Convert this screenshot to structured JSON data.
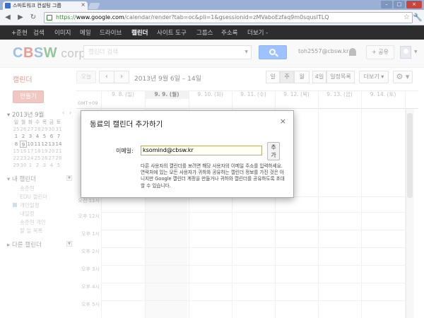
{
  "browser": {
    "tab_title": "스마트워크 컨설팅 그룹",
    "tab_close": "×",
    "url_scheme": "https://",
    "url_domain": "www.google.com",
    "url_path": "/calendar/render?tab=oc&pli=1&gsessionid=zMVaboEzfaq9m0squsITLQ",
    "back": "◀",
    "forward": "▶",
    "reload": "↻",
    "star": "☆",
    "wrench": "🔧",
    "win_min": "–",
    "win_max": "□",
    "win_close": "×"
  },
  "gbar": {
    "items": [
      "+준현",
      "검색",
      "이미지",
      "메일",
      "드라이브",
      "캘린더",
      "사이트 도구",
      "그룹스",
      "주소록",
      "더보기 -"
    ]
  },
  "header": {
    "logo_c": "C",
    "logo_b": "B",
    "logo_s": "S",
    "logo_w": "W",
    "logo_corp": " corp.",
    "search_placeholder": "캘린더 검색",
    "search_dd": "▼",
    "email": "toh2557@cbsw.kr",
    "share_label": "+ 공유",
    "avatar_dd": "▼"
  },
  "toolbar": {
    "calendar_title": "캘린더",
    "today": "오늘",
    "prev": "‹",
    "next": "›",
    "range": "2013년 9월 6일 – 14일",
    "views": [
      "일",
      "주",
      "월",
      "4일",
      "일정목록"
    ],
    "more": "더보기 ▾",
    "gear": "⚙ ▾"
  },
  "sidebar": {
    "create": "만들기",
    "mini_title": "▾ 2013년 9월",
    "mini_prev": "‹",
    "mini_next": "›",
    "weekdays": [
      "일",
      "월",
      "화",
      "수",
      "목",
      "금",
      "토"
    ],
    "weeks": [
      [
        "25",
        "26",
        "27",
        "28",
        "29",
        "30",
        "31"
      ],
      [
        "1",
        "2",
        "3",
        "4",
        "5",
        "6",
        "7"
      ],
      [
        "8",
        "9",
        "10",
        "11",
        "12",
        "13",
        "14"
      ],
      [
        "15",
        "16",
        "17",
        "18",
        "19",
        "20",
        "21"
      ],
      [
        "22",
        "23",
        "24",
        "25",
        "26",
        "27",
        "28"
      ],
      [
        "29",
        "30",
        "1",
        "2",
        "3",
        "4",
        "5"
      ]
    ],
    "my_calendars": "▾ 내 캘린더",
    "calendars": [
      "송준현",
      "EDU 캘린더",
      "개인일정",
      "내일정",
      "송준현 개인",
      "할 일 목록"
    ],
    "other_calendars": "▸ 다른 캘린더",
    "dd": "▼"
  },
  "grid": {
    "gmt": "GMT+09",
    "days": [
      "9. 8. (일)",
      "9. 9. (월)",
      "9. 10. (화)",
      "9. 11. (수)",
      "9. 12. (목)",
      "9. 13. (금)",
      "9. 14. (토)"
    ],
    "hours": [
      "오전 11시",
      "오후 12시",
      "오후 1시",
      "오후 2시",
      "오후 3시",
      "오후 4시",
      "오후 5시"
    ],
    "early_label": "오전 7시"
  },
  "dialog": {
    "title": "동료의 캘린더 추가하기",
    "close": "×",
    "email_label": "이메일:",
    "email_value": "ksomind@cbsw.kr",
    "add_button": "추가",
    "help": "다른 사용자의 캘린더를 보려면 해당 사용자의 이메일 주소를 입력하세요. 연락처에 있는 모든 사용자가 귀하와 공유하는 캘린더 정보를 가진 것은 아니지만 Google 캘린더 계정을 만들거나 귀하와 캘린더를 공유하도록 초대할 수 있습니다."
  }
}
